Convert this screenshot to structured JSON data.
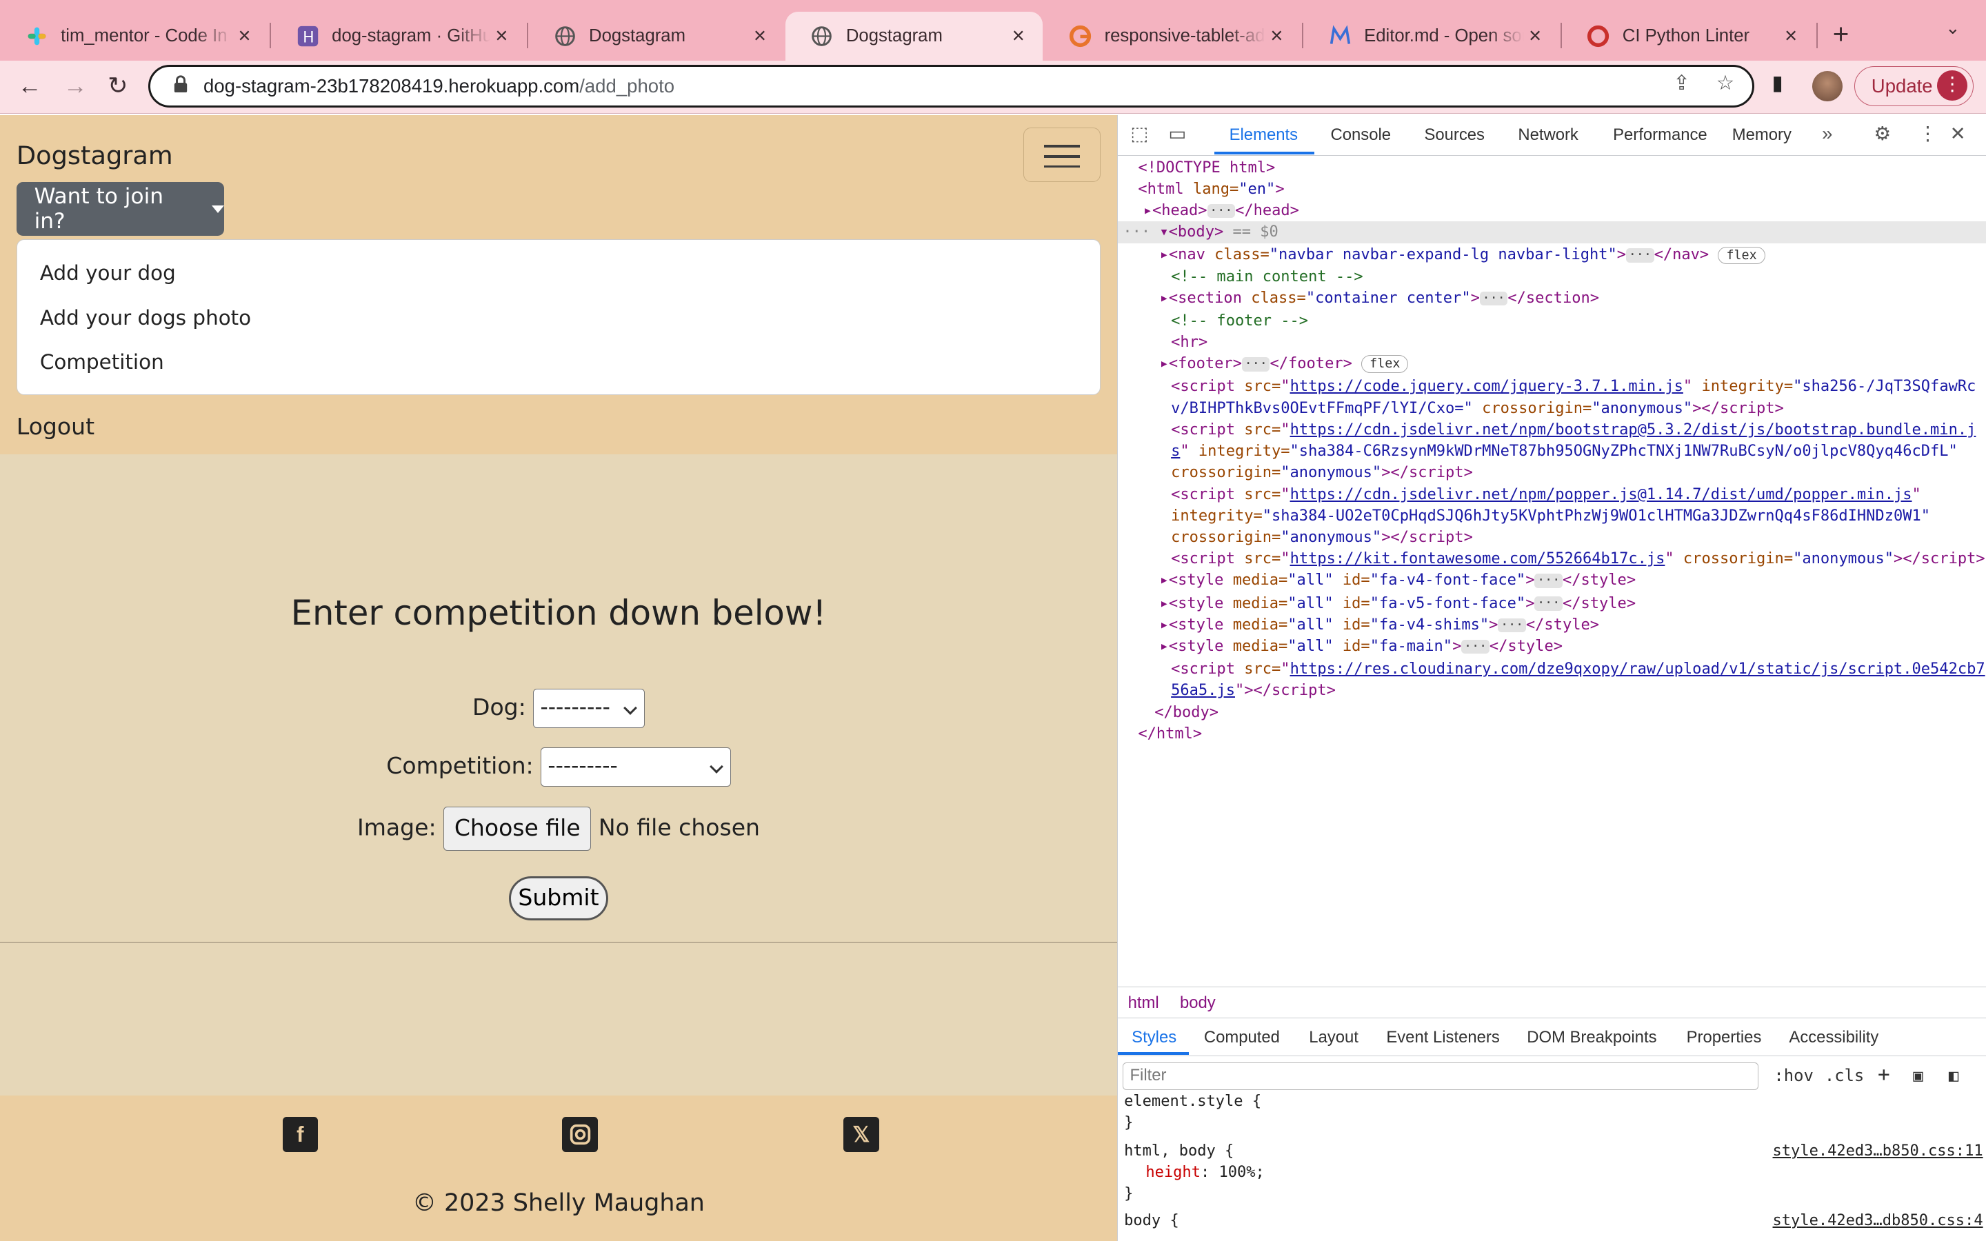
{
  "browser": {
    "tabs": [
      {
        "title": "tim_mentor - Code In",
        "icon": "slack-icon"
      },
      {
        "title": "dog-stagram · GitHub",
        "icon": "heroku-icon"
      },
      {
        "title": "Dogstagram",
        "icon": "globe-icon"
      },
      {
        "title": "Dogstagram",
        "icon": "globe-icon"
      },
      {
        "title": "responsive-tablet-ad",
        "icon": "grammarly-icon"
      },
      {
        "title": "Editor.md - Open sou",
        "icon": "editor-icon"
      },
      {
        "title": "CI Python Linter",
        "icon": "ci-icon"
      }
    ],
    "url_host": "dog-stagram-23b178208419.herokuapp.com",
    "url_path": "/add_photo",
    "update_label": "Update",
    "accent": "#f4b3c0"
  },
  "site": {
    "brand": "Dogstagram",
    "dropdown_label": "Want to join in?",
    "dropdown_items": [
      "Add your dog",
      "Add your dogs photo",
      "Competition"
    ],
    "logout": "Logout",
    "heading": "Enter competition down below!",
    "form": {
      "dog_label": "Dog:",
      "dog_value": "---------",
      "competition_label": "Competition:",
      "competition_value": "---------",
      "image_label": "Image:",
      "file_button": "Choose file",
      "file_status": "No file chosen",
      "submit": "Submit"
    },
    "copyright": "© 2023 Shelly Maughan"
  },
  "devtools": {
    "tabs": [
      "Elements",
      "Console",
      "Sources",
      "Network",
      "Performance",
      "Memory"
    ],
    "code": {
      "doctype": "<!DOCTYPE html>",
      "html_open_a": "<html ",
      "lang_attr": "lang=",
      "lang_val": "\"en\"",
      "head": "<head>",
      "head_close": "</head>",
      "body": "<body>",
      "body_eq": " == $0",
      "nav_open": "<nav ",
      "nav_attr": "class=",
      "nav_val": "\"navbar navbar-expand-lg navbar-light\"",
      "nav_close": "</nav>",
      "flex_badge": "flex",
      "comment_main": "<!-- main content -->",
      "section_open": "<section ",
      "section_val": "\"container center\"",
      "section_close": "</section>",
      "comment_footer": "<!-- footer -->",
      "hr": "<hr>",
      "footer_open": "<footer>",
      "footer_close": "</footer>",
      "script_jquery_url": "https://code.jquery.com/jquery-3.7.1.min.js",
      "script_jquery_integrity": "\"sha256-/JqT3SQfawRc",
      "script_jquery_integrity2": "v/BIHPThkBvs0OEvtFFmqPF/lYI/Cxo=\"",
      "crossorigin": "crossorigin=",
      "anon": "\"anonymous\"",
      "script_bootstrap_url": "https://cdn.jsdelivr.net/npm/bootstrap@5.3.2/dist/js/bootstrap.bundle.min.j",
      "script_bootstrap_url2": "s",
      "script_bootstrap_integrity": "\"sha384-C6RzsynM9kWDrMNeT87bh95OGNyZPhcTNXj1NW7RuBCsyN/o0jlpcV8Qyq46cDfL\"",
      "script_popper_url": "https://cdn.jsdelivr.net/npm/popper.js@1.14.7/dist/umd/popper.min.js",
      "script_popper_integrity": "\"sha384-UO2eT0CpHqdSJQ6hJty5KVphtPhzWj9WO1clHTMGa3JDZwrnQq4sF86dIHNDz0W1\"",
      "script_fa_url": "https://kit.fontawesome.com/552664b17c.js",
      "style_ids": [
        "\"fa-v4-font-face\"",
        "\"fa-v5-font-face\"",
        "\"fa-v4-shims\"",
        "\"fa-main\""
      ],
      "script_cloud_url": "https://res.cloudinary.com/dze9qxopy/raw/upload/v1/static/js/script.0e542cb7",
      "script_cloud_url2": "56a5.js",
      "body_close": "</body>",
      "html_close": "</html>"
    },
    "breadcrumb": [
      "html",
      "body"
    ],
    "style_tabs": [
      "Styles",
      "Computed",
      "Layout",
      "Event Listeners",
      "DOM Breakpoints",
      "Properties",
      "Accessibility"
    ],
    "filter_placeholder": "Filter",
    "hov": ":hov",
    "cls": ".cls",
    "rules": {
      "element_style": "element.style {",
      "close": "}",
      "html_body": "html, body {",
      "height_prop": "height",
      "height_val": "100%;",
      "src1": "style.42ed3…b850.css:11",
      "body_sel": "body {",
      "src2": "style.42ed3…db850.css:4"
    }
  }
}
